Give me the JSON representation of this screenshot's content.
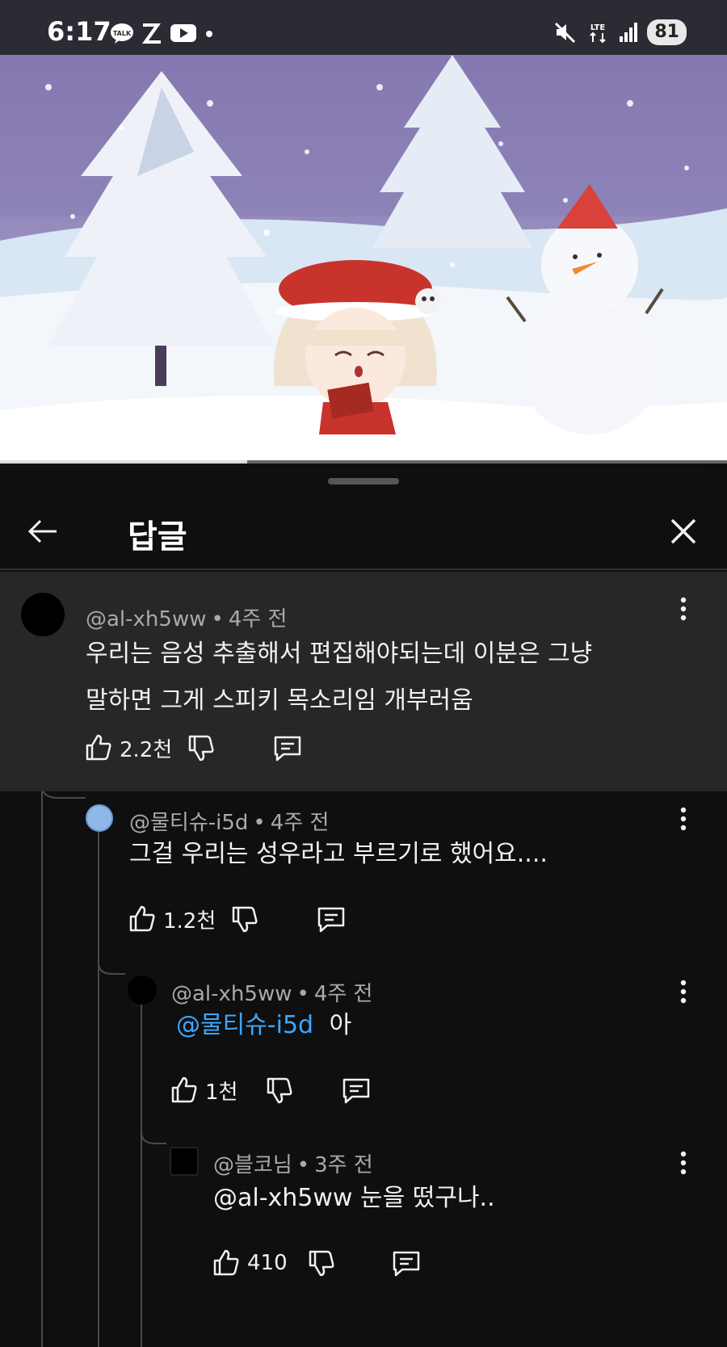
{
  "status_bar": {
    "time": "6:17",
    "left_icons": [
      "kakaotalk-icon",
      "z-app-icon",
      "youtube-icon",
      "dot-icon"
    ],
    "network": "LTE",
    "battery": "81"
  },
  "video": {
    "progress_fraction": 0.34
  },
  "panel": {
    "title": "답글",
    "back_icon": "arrow-left-icon",
    "close_icon": "close-icon"
  },
  "comments": [
    {
      "handle": "@al-xh5ww",
      "time": "4주 전",
      "lines": [
        "우리는 음성 추출해서 편집해야되는데 이분은 그냥",
        "말하면 그게 스피키 목소리임 개부러움"
      ],
      "likes": "2.2천",
      "avatar_color": "#000000"
    },
    {
      "handle": "@물티슈-i5d",
      "time": "4주 전",
      "text": "그걸 우리는 성우라고 부르기로 했어요....",
      "likes": "1.2천",
      "avatar_color": "#8fb8e8"
    },
    {
      "handle": "@al-xh5ww",
      "time": "4주 전",
      "mention": "@물티슈-i5d",
      "text": "아",
      "likes": "1천",
      "avatar_color": "#000000"
    },
    {
      "handle": "@블코님",
      "time": "3주 전",
      "text": "@al-xh5ww 눈을 떴구나..",
      "likes": "410",
      "avatar_color": "#000000"
    }
  ],
  "colors": {
    "background": "#0f0f0f",
    "highlight_bg": "#272727",
    "mention": "#3ea6ff",
    "meta": "#aaaaaa"
  }
}
